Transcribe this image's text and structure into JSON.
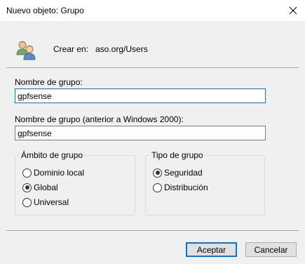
{
  "window": {
    "title": "Nuevo objeto: Grupo"
  },
  "header": {
    "create_in_label": "Crear en:",
    "create_in_value": "aso.org/Users",
    "icon": "group-users-icon"
  },
  "form": {
    "group_name_label": "Nombre de grupo:",
    "group_name_value": "gpfsense",
    "group_name_pre2000_label": "Nombre de grupo (anterior a Windows 2000):",
    "group_name_pre2000_value": "gpfsense"
  },
  "group_scope": {
    "title": "Ámbito de grupo",
    "options": [
      {
        "label": "Dominio local",
        "checked": false
      },
      {
        "label": "Global",
        "checked": true
      },
      {
        "label": "Universal",
        "checked": false
      }
    ]
  },
  "group_type": {
    "title": "Tipo de grupo",
    "options": [
      {
        "label": "Seguridad",
        "checked": true
      },
      {
        "label": "Distribución",
        "checked": false
      }
    ]
  },
  "buttons": {
    "accept": "Aceptar",
    "cancel": "Cancelar"
  },
  "colors": {
    "focus_accent": "#0078d7",
    "dialog_background": "#f0f0f0"
  }
}
